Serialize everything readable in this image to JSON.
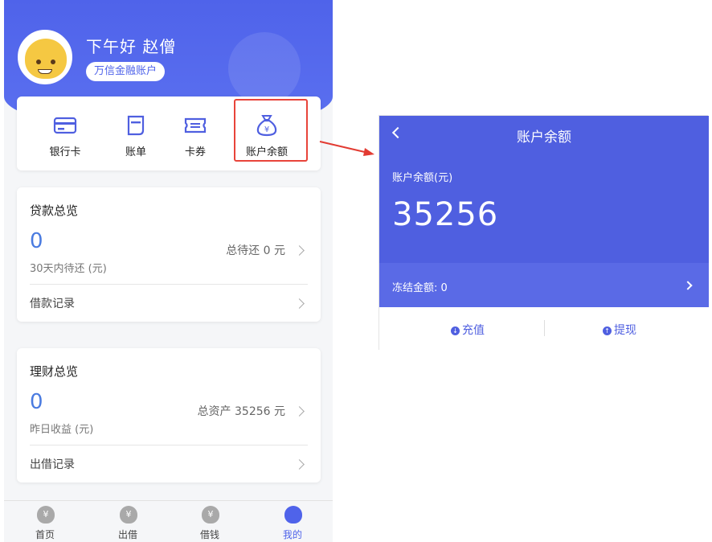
{
  "phone": {
    "greeting": "下午好 赵僧",
    "account_tag": "万信金融账户",
    "quick_actions": [
      {
        "label": "银行卡",
        "icon": "bank-card-icon"
      },
      {
        "label": "账单",
        "icon": "bill-icon"
      },
      {
        "label": "卡券",
        "icon": "coupon-icon"
      },
      {
        "label": "账户余额",
        "icon": "money-bag-icon"
      }
    ],
    "loan": {
      "title": "贷款总览",
      "amount": "0",
      "subtitle": "30天内待还 (元)",
      "total": "总待还 0 元",
      "link": "借款记录"
    },
    "wealth": {
      "title": "理财总览",
      "amount": "0",
      "subtitle": "昨日收益 (元)",
      "total": "总资产 35256 元",
      "link": "出借记录"
    },
    "tabs": [
      {
        "label": "首页",
        "icon": "home-money-icon"
      },
      {
        "label": "出借",
        "icon": "lend-icon"
      },
      {
        "label": "借钱",
        "icon": "borrow-icon"
      },
      {
        "label": "我的",
        "icon": "user-icon"
      }
    ]
  },
  "panel": {
    "title": "账户余额",
    "balance_label": "账户余额(元)",
    "balance_value": "35256",
    "frozen_label": "冻结金额: 0",
    "actions": {
      "recharge": "充值",
      "withdraw": "提现"
    }
  },
  "colors": {
    "primary": "#4f5fe0",
    "highlight": "#e8443a",
    "amount_blue": "#4a7be0"
  }
}
